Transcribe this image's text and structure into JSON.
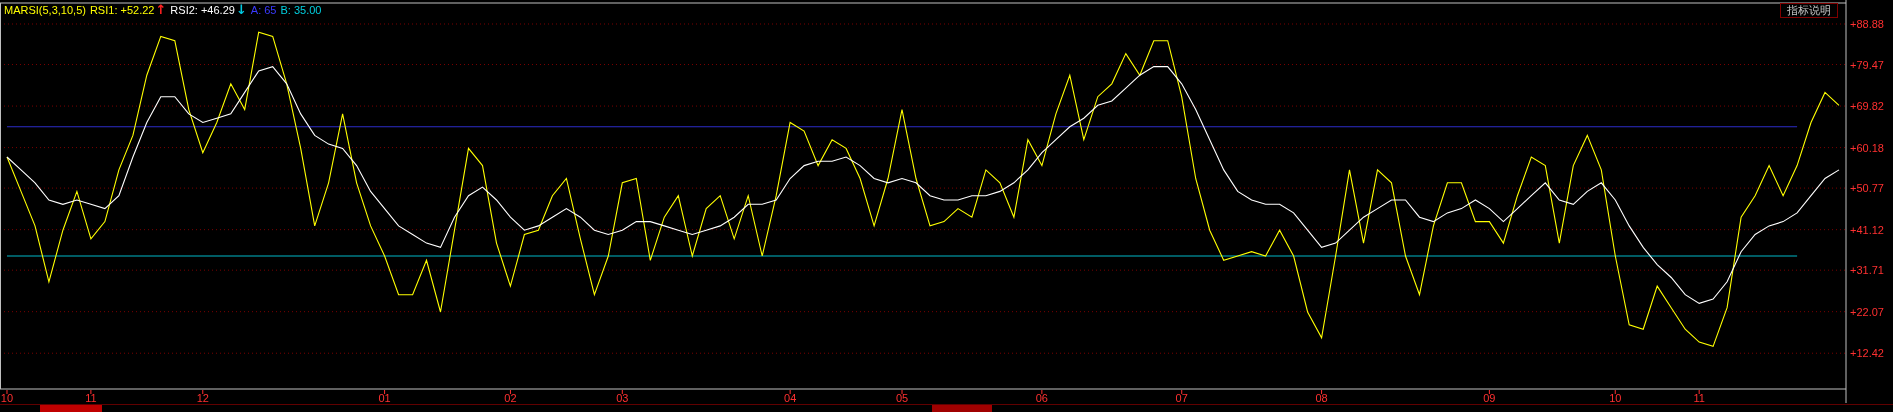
{
  "indicator_legend": {
    "items": [
      {
        "kind": "name",
        "label": "MARSI(5,3,10,5)",
        "color": "#ffff00"
      },
      {
        "kind": "value",
        "label": "RSI1: +52.22",
        "color": "#ffff00"
      },
      {
        "kind": "arrow",
        "label": "↑",
        "color": "#ff2020"
      },
      {
        "kind": "value",
        "label": "RSI2: +46.29",
        "color": "#ffffff"
      },
      {
        "kind": "arrow",
        "label": "↓",
        "color": "#00c8e0"
      },
      {
        "kind": "value",
        "label": "A: 65",
        "color": "#3a3aff"
      },
      {
        "kind": "value",
        "label": "B: 35.00",
        "color": "#00d0e0"
      }
    ]
  },
  "help_button": "指标说明",
  "chart_data": {
    "type": "line",
    "categories": [
      "10",
      null,
      null,
      null,
      null,
      null,
      "11",
      null,
      null,
      null,
      null,
      null,
      null,
      null,
      "12",
      null,
      null,
      null,
      null,
      null,
      null,
      null,
      null,
      null,
      null,
      null,
      null,
      "01",
      null,
      null,
      null,
      null,
      null,
      null,
      null,
      null,
      "02",
      null,
      null,
      null,
      null,
      null,
      null,
      null,
      "03",
      null,
      null,
      null,
      null,
      null,
      null,
      null,
      null,
      null,
      null,
      null,
      "04",
      null,
      null,
      null,
      null,
      null,
      null,
      null,
      "05",
      null,
      null,
      null,
      null,
      null,
      null,
      null,
      null,
      null,
      "06",
      null,
      null,
      null,
      null,
      null,
      null,
      null,
      null,
      null,
      "07",
      null,
      null,
      null,
      null,
      null,
      null,
      null,
      null,
      null,
      "08",
      null,
      null,
      null,
      null,
      null,
      null,
      null,
      null,
      null,
      null,
      null,
      "09",
      null,
      null,
      null,
      null,
      null,
      null,
      null,
      null,
      "10",
      null,
      null,
      null,
      null,
      null,
      "11",
      null,
      null,
      null,
      null,
      null,
      null,
      null,
      null,
      null,
      null
    ],
    "series": [
      {
        "color": "#2c2cc8",
        "values": [
          65,
          65,
          65,
          65,
          65,
          65,
          65,
          65,
          65,
          65,
          65,
          65,
          65,
          65,
          65,
          65,
          65,
          65,
          65,
          65,
          65,
          65,
          65,
          65,
          65,
          65,
          65,
          65,
          65,
          65,
          65,
          65,
          65,
          65,
          65,
          65,
          65,
          65,
          65,
          65,
          65,
          65,
          65,
          65,
          65,
          65,
          65,
          65,
          65,
          65,
          65,
          65,
          65,
          65,
          65,
          65,
          65,
          65,
          65,
          65,
          65,
          65,
          65,
          65,
          65,
          65,
          65,
          65,
          65,
          65,
          65,
          65,
          65,
          65,
          65,
          65,
          65,
          65,
          65,
          65,
          65,
          65,
          65,
          65,
          65,
          65,
          65,
          65,
          65,
          65,
          65,
          65,
          65,
          65,
          65,
          65,
          65,
          65,
          65,
          65,
          65,
          65,
          65,
          65,
          65,
          65,
          65,
          65,
          65,
          65,
          65,
          65,
          65,
          65,
          65,
          65,
          65,
          65,
          65,
          65,
          65,
          65,
          65,
          65,
          65,
          65,
          65,
          65,
          65,
          null,
          null,
          null
        ]
      },
      {
        "color": "#00b8c8",
        "values": [
          35,
          35,
          35,
          35,
          35,
          35,
          35,
          35,
          35,
          35,
          35,
          35,
          35,
          35,
          35,
          35,
          35,
          35,
          35,
          35,
          35,
          35,
          35,
          35,
          35,
          35,
          35,
          35,
          35,
          35,
          35,
          35,
          35,
          35,
          35,
          35,
          35,
          35,
          35,
          35,
          35,
          35,
          35,
          35,
          35,
          35,
          35,
          35,
          35,
          35,
          35,
          35,
          35,
          35,
          35,
          35,
          35,
          35,
          35,
          35,
          35,
          35,
          35,
          35,
          35,
          35,
          35,
          35,
          35,
          35,
          35,
          35,
          35,
          35,
          35,
          35,
          35,
          35,
          35,
          35,
          35,
          35,
          35,
          35,
          35,
          35,
          35,
          35,
          35,
          35,
          35,
          35,
          35,
          35,
          35,
          35,
          35,
          35,
          35,
          35,
          35,
          35,
          35,
          35,
          35,
          35,
          35,
          35,
          35,
          35,
          35,
          35,
          35,
          35,
          35,
          35,
          35,
          35,
          35,
          35,
          35,
          35,
          35,
          35,
          35,
          35,
          35,
          35,
          35,
          null,
          null,
          null
        ]
      },
      {
        "color": "#ffff00",
        "values": [
          58,
          50,
          42,
          29,
          41,
          50,
          39,
          43,
          55,
          63,
          77,
          86,
          85,
          69,
          59,
          66,
          75,
          69,
          87,
          86,
          75,
          60,
          42,
          52,
          68,
          52,
          42,
          35,
          26,
          26,
          34,
          22,
          41,
          60,
          56,
          38,
          28,
          40,
          41,
          49,
          53,
          39,
          26,
          35,
          52,
          53,
          34,
          44,
          49,
          35,
          46,
          49,
          39,
          49,
          35,
          49,
          66,
          64,
          56,
          62,
          60,
          53,
          42,
          53,
          69,
          53,
          42,
          43,
          46,
          44,
          55,
          52,
          44,
          62,
          56,
          68,
          77,
          62,
          72,
          75,
          82,
          77,
          85,
          85,
          72,
          53,
          41,
          34,
          35,
          36,
          35,
          41,
          35,
          22,
          16,
          35,
          55,
          38,
          55,
          52,
          35,
          26,
          42,
          52,
          52,
          43,
          43,
          38,
          49,
          58,
          56,
          38,
          56,
          63,
          55,
          35,
          19,
          18,
          28,
          23,
          18,
          15,
          14,
          23,
          44,
          49,
          56,
          49,
          56,
          66,
          73,
          70
        ]
      },
      {
        "color": "#ffffff",
        "values": [
          58,
          55,
          52,
          48,
          47,
          48,
          47,
          46,
          49,
          58,
          66,
          72,
          72,
          68,
          66,
          67,
          68,
          73,
          78,
          79,
          75,
          68,
          63,
          61,
          60,
          56,
          50,
          46,
          42,
          40,
          38,
          37,
          44,
          49,
          51,
          48,
          44,
          41,
          42,
          44,
          46,
          44,
          41,
          40,
          41,
          43,
          43,
          42,
          41,
          40,
          41,
          42,
          44,
          47,
          47,
          48,
          53,
          56,
          57,
          57,
          58,
          56,
          53,
          52,
          53,
          52,
          49,
          48,
          48,
          49,
          49,
          50,
          52,
          55,
          59,
          62,
          65,
          67,
          70,
          71,
          74,
          77,
          79,
          79,
          75,
          69,
          62,
          55,
          50,
          48,
          47,
          47,
          45,
          41,
          37,
          38,
          41,
          44,
          46,
          48,
          48,
          44,
          43,
          45,
          46,
          48,
          46,
          43,
          46,
          49,
          52,
          48,
          47,
          50,
          52,
          48,
          42,
          37,
          33,
          30,
          26,
          24,
          25,
          29,
          36,
          40,
          42,
          43,
          45,
          49,
          53,
          55
        ]
      }
    ],
    "ylim": [
      4.11,
      93.76
    ],
    "grid": true,
    "yticks": [
      {
        "value": 88.88,
        "label": "+88.88"
      },
      {
        "value": 79.47,
        "label": "+79.47"
      },
      {
        "value": 69.82,
        "label": "+69.82"
      },
      {
        "value": 60.18,
        "label": "+60.18"
      },
      {
        "value": 50.77,
        "label": "+50.77"
      },
      {
        "value": 41.12,
        "label": "+41.12"
      },
      {
        "value": 31.71,
        "label": "+31.71"
      },
      {
        "value": 22.07,
        "label": "+22.07"
      },
      {
        "value": 12.42,
        "label": "+12.42"
      }
    ]
  }
}
